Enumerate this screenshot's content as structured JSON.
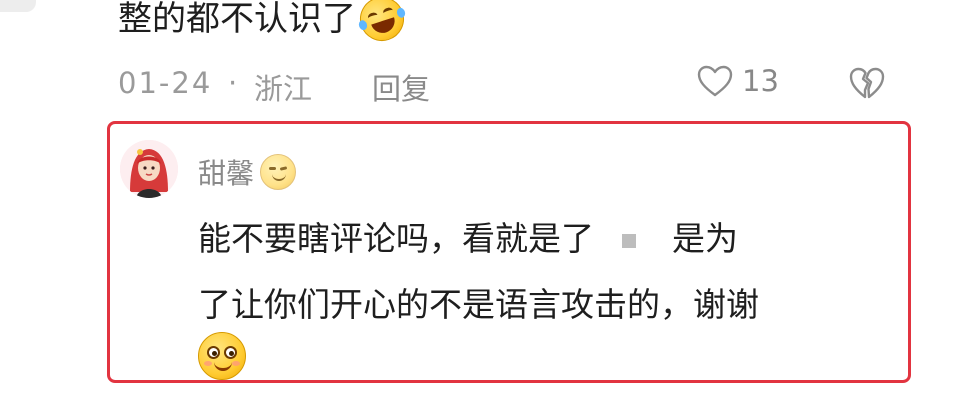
{
  "comment": {
    "text": "整的都不认识了",
    "emoji": "laughing-tears-emoji",
    "date": "01-24",
    "separator": "·",
    "location": "浙江",
    "reply_label": "回复",
    "like_count": "13",
    "like_icon": "heart-outline-icon",
    "dislike_icon": "broken-heart-icon"
  },
  "reply": {
    "highlight_color": "#e23440",
    "author_name": "甜馨",
    "author_emoji": "wink-emoji",
    "line1_before": "能不要瞎评论吗，看就是了",
    "line1_after": "是为",
    "line2": "了让你们开心的不是语言攻击的，谢谢",
    "trailing_emoji": "smile-emoji"
  }
}
